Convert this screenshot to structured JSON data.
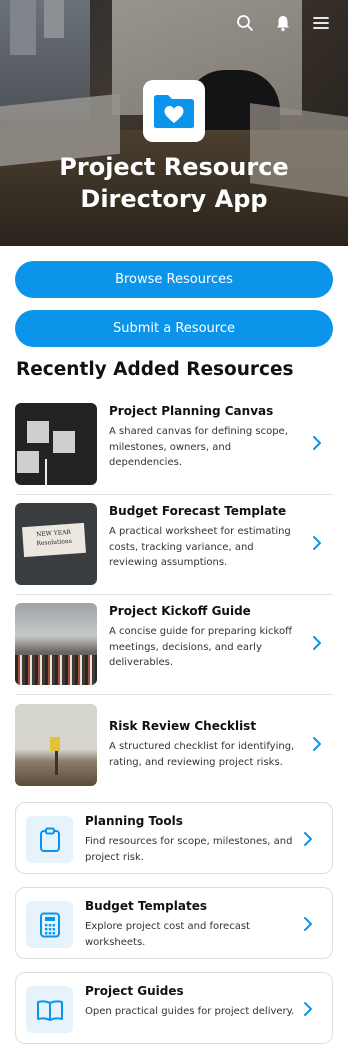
{
  "hero": {
    "title_line1": "Project Resource",
    "title_line2": "Directory App",
    "icons": [
      "search-icon",
      "notification-icon",
      "menu-icon"
    ]
  },
  "actions": {
    "browse_label": "Browse Resources",
    "submit_label": "Submit a Resource"
  },
  "section": {
    "recent_title": "Recently Added Resources"
  },
  "resources": [
    {
      "title": "Project Planning Canvas",
      "description": "A shared canvas for defining scope, milestones, owners, and dependencies."
    },
    {
      "title": "Budget Forecast Template",
      "description": "A practical worksheet for estimating costs, tracking variance, and reviewing assumptions.",
      "thumb_text": "NEW YEAR Resolutions"
    },
    {
      "title": "Project Kickoff Guide",
      "description": "A concise guide for preparing kickoff meetings, decisions, and early deliverables."
    },
    {
      "title": "Risk Review Checklist",
      "description": "A structured checklist for identifying, rating, and reviewing project risks."
    }
  ],
  "categories": [
    {
      "title": "Planning Tools",
      "description": "Find resources for scope, milestones, and project risk.",
      "icon": "clipboard-icon"
    },
    {
      "title": "Budget Templates",
      "description": "Explore project cost and forecast worksheets.",
      "icon": "calculator-icon"
    },
    {
      "title": "Project Guides",
      "description": "Open practical guides for project delivery.",
      "icon": "book-icon"
    }
  ],
  "colors": {
    "accent": "#0b95ea",
    "icon_bg": "#e6f3fb"
  }
}
